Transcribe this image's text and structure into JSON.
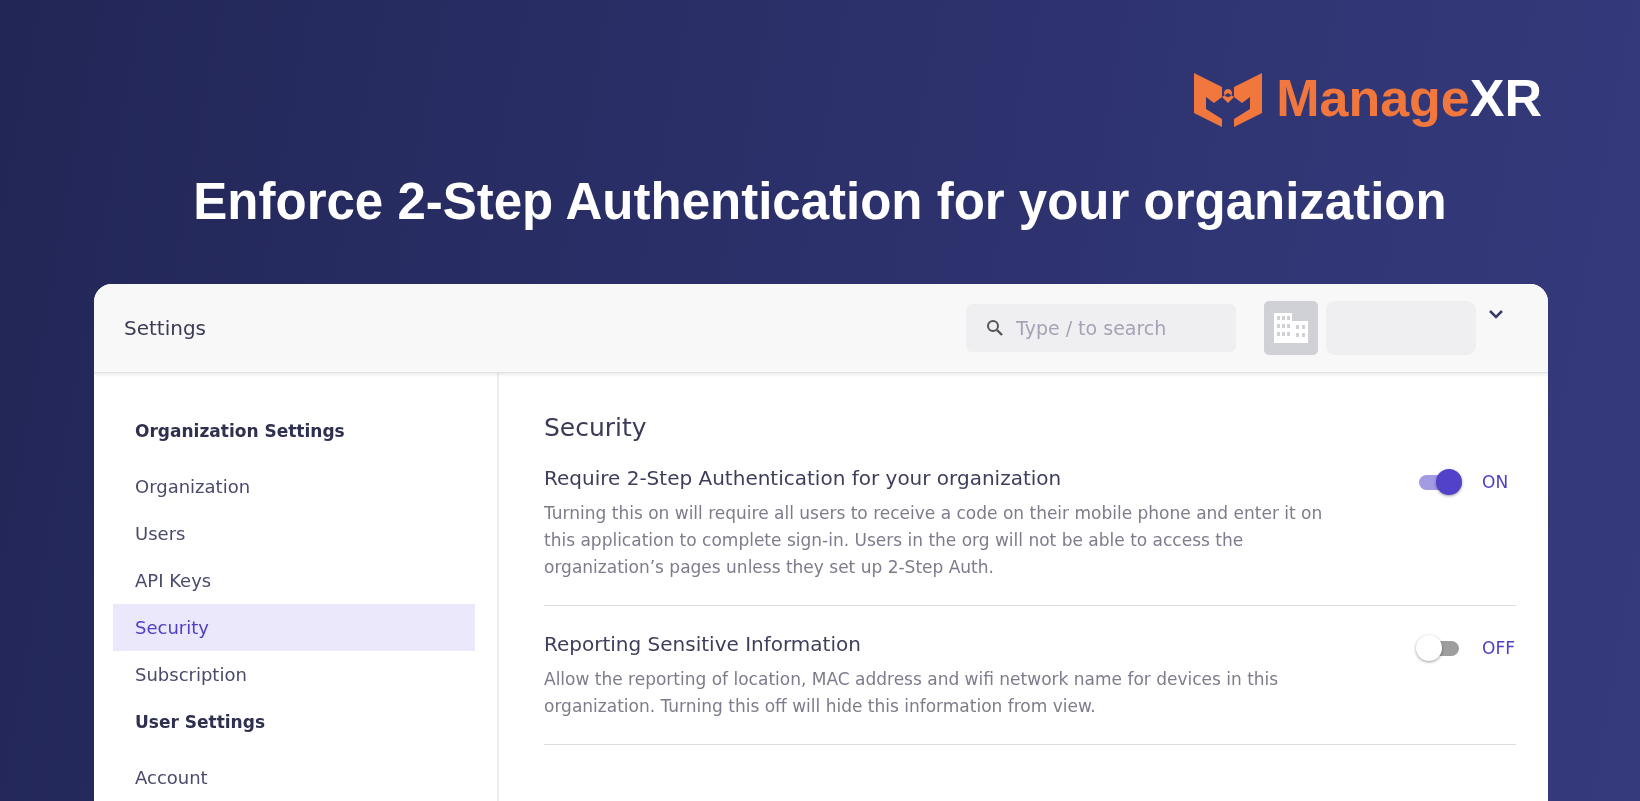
{
  "logo": {
    "parts": [
      "Manage",
      "XR"
    ]
  },
  "headline": "Enforce 2-Step Authentication for your organization",
  "window": {
    "title": "Settings"
  },
  "search": {
    "placeholder": "Type / to search"
  },
  "sidebar": {
    "sections": [
      {
        "heading": "Organization Settings",
        "items": [
          {
            "label": "Organization",
            "selected": false
          },
          {
            "label": "Users",
            "selected": false
          },
          {
            "label": "API Keys",
            "selected": false
          },
          {
            "label": "Security",
            "selected": true
          },
          {
            "label": "Subscription",
            "selected": false
          }
        ]
      },
      {
        "heading": "User Settings",
        "items": [
          {
            "label": "Account",
            "selected": false
          }
        ]
      }
    ]
  },
  "page": {
    "title": "Security",
    "settings": [
      {
        "title": "Require 2-Step Authentication for your organization",
        "description": "Turning this on will require all users to receive a code on their mobile phone and enter it on this application to complete sign-in. Users in the org will not be able to access the organization’s pages unless they set up 2-Step Auth.",
        "on": true,
        "state_label": "ON"
      },
      {
        "title": "Reporting Sensitive Information",
        "description": "Allow the reporting of location, MAC address and wifi network name for devices in this organization. Turning this off will hide this information from view.",
        "on": false,
        "state_label": "OFF"
      }
    ]
  }
}
